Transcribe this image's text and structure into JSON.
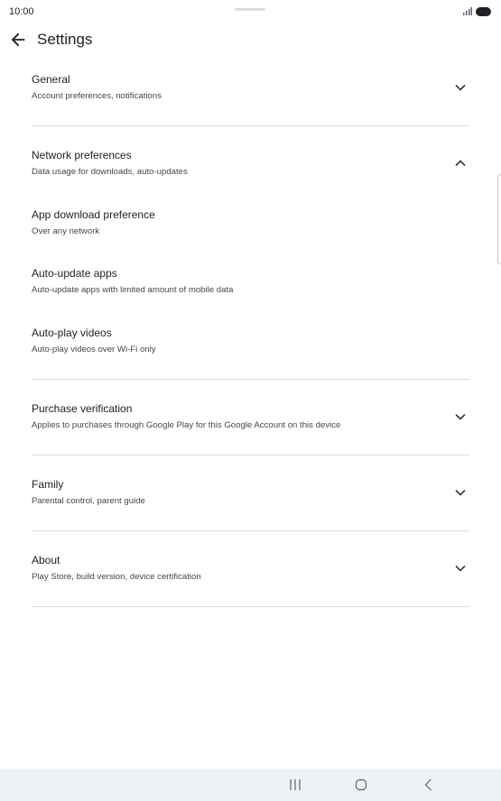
{
  "status_bar": {
    "time": "10:00",
    "icons": [
      "signal-icon",
      "battery-icon"
    ]
  },
  "app_bar": {
    "title": "Settings",
    "back_icon": "arrow-back-icon"
  },
  "settings": {
    "items": [
      {
        "title": "General",
        "subtitle": "Account preferences, notifications",
        "expandable": true,
        "expanded": false
      },
      {
        "title": "Network preferences",
        "subtitle": "Data usage for downloads, auto-updates",
        "expandable": true,
        "expanded": true
      },
      {
        "title": "App download preference",
        "subtitle": "Over any network",
        "expandable": false
      },
      {
        "title": "Auto-update apps",
        "subtitle": "Auto-update apps with limited amount of mobile data",
        "expandable": false
      },
      {
        "title": "Auto-play videos",
        "subtitle": "Auto-play videos over Wi-Fi only",
        "expandable": false
      },
      {
        "title": "Purchase verification",
        "subtitle": "Applies to purchases through Google Play for this Google Account on this device",
        "expandable": true,
        "expanded": false
      },
      {
        "title": "Family",
        "subtitle": "Parental control, parent guide",
        "expandable": true,
        "expanded": false
      },
      {
        "title": "About",
        "subtitle": "Play Store, build version, device certification",
        "expandable": true,
        "expanded": false
      }
    ]
  },
  "nav_bar": {
    "icons": [
      "recent-apps-icon",
      "home-icon",
      "back-icon"
    ]
  },
  "colors": {
    "text_primary": "#1f1f1f",
    "text_secondary": "#444746",
    "divider": "#dadce0",
    "nav_background": "#eef2f6"
  }
}
